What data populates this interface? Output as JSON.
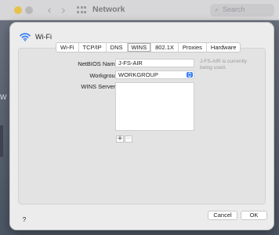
{
  "background_window": {
    "title": "Network",
    "search_placeholder": "Search",
    "left_letter": "W"
  },
  "sheet": {
    "title": "Wi-Fi",
    "tabs": [
      {
        "label": "Wi-Fi",
        "selected": false
      },
      {
        "label": "TCP/IP",
        "selected": false
      },
      {
        "label": "DNS",
        "selected": false
      },
      {
        "label": "WINS",
        "selected": true
      },
      {
        "label": "802.1X",
        "selected": false
      },
      {
        "label": "Proxies",
        "selected": false
      },
      {
        "label": "Hardware",
        "selected": false
      }
    ],
    "form": {
      "netbios_label": "NetBIOS Name:",
      "netbios_value": "J-FS-AIR",
      "netbios_note": "J-FS-AIR is currently being used.",
      "workgroup_label": "Workgroup:",
      "workgroup_value": "WORKGROUP",
      "wins_label": "WINS Servers:",
      "add_symbol": "+",
      "remove_symbol": "−"
    },
    "footer": {
      "help_label": "?",
      "cancel_label": "Cancel",
      "ok_label": "OK"
    }
  },
  "colors": {
    "accent": "#2f7bf6",
    "sheet_bg": "#ececec"
  }
}
